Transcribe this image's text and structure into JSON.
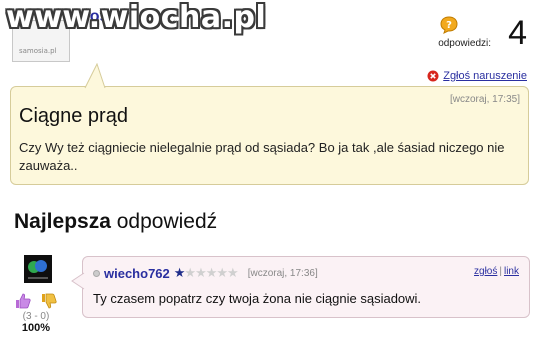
{
  "watermark": "www.wiocha.pl",
  "question": {
    "asker_name": "gość",
    "asker_avatar_text": "samosia.pl",
    "answers_label": "odpowiedzi:",
    "answers_count": "4",
    "report_label": "Zgłoś naruszenie",
    "timestamp": "[wczoraj, 17:35]",
    "title": "Ciągne prąd",
    "body": "Czy Wy też ciągniecie nielegalnie prąd od sąsiada? Bo ja tak ,ale śasiad niczego nie zauważa.."
  },
  "best_answer": {
    "heading_bold": "Najlepsza",
    "heading_rest": " odpowiedź",
    "user": "wiecho762",
    "rating": 1,
    "rating_max": 6,
    "timestamp": "[wczoraj, 17:36]",
    "report_link": "zgłoś",
    "separator": "|",
    "link_label": "link",
    "text": "Ty czasem popatrz czy twoja żona nie ciągnie sąsiadowi.",
    "vote_counts": "(3 - 0)",
    "vote_percent": "100%"
  },
  "colors": {
    "link": "#2a2fa0",
    "question_bg": "#fdf8dc",
    "answer_bg": "#fbf2f5",
    "star_on": "#1f2d8a"
  }
}
